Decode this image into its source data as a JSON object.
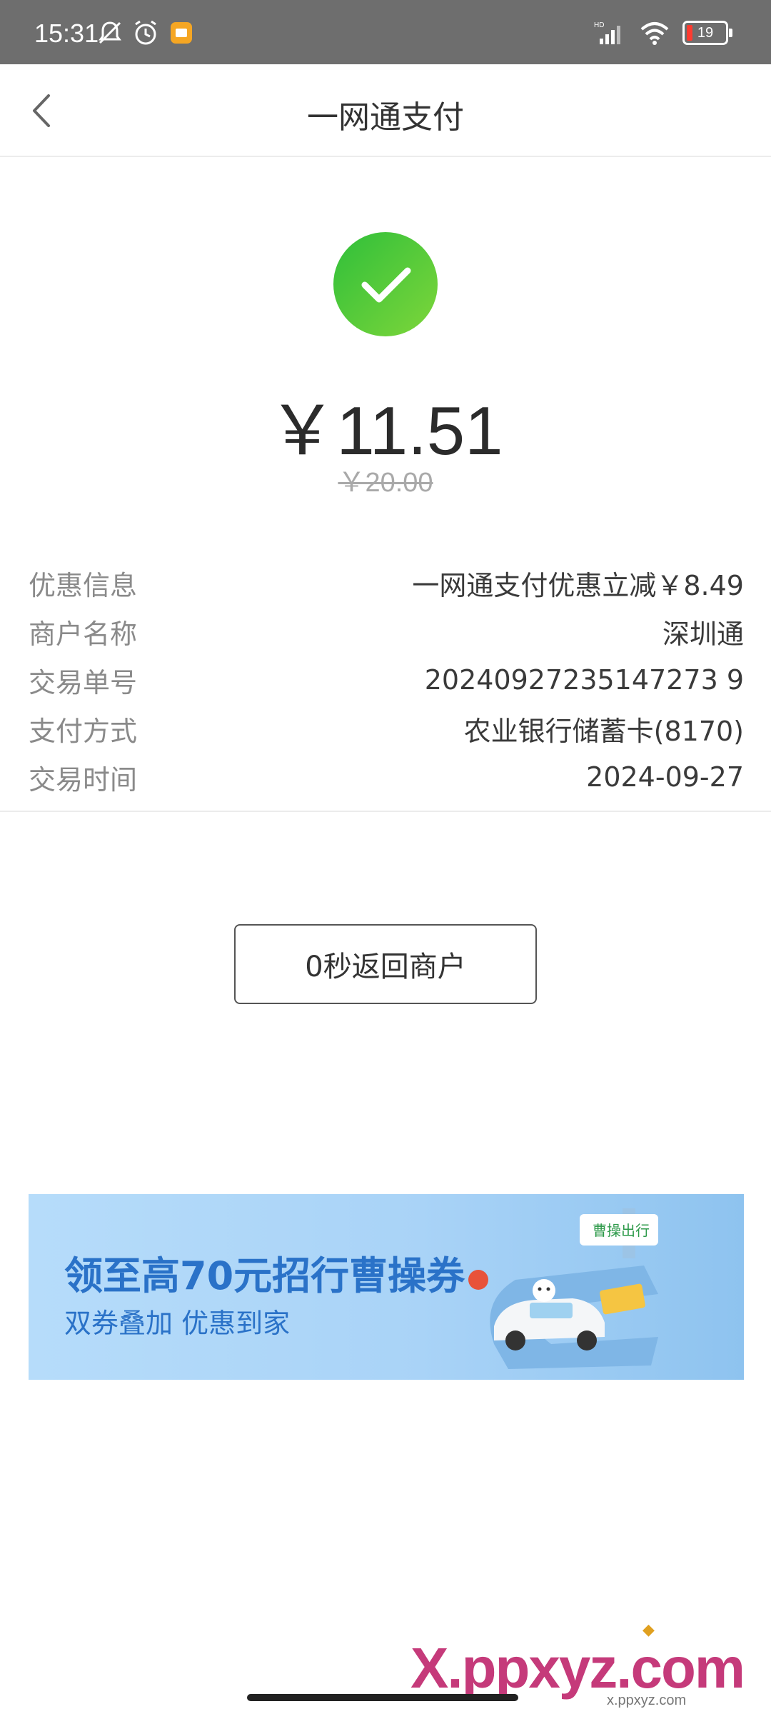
{
  "status_bar": {
    "time": "15:31",
    "battery": "19",
    "icons": [
      "muted-bell-icon",
      "alarm-icon",
      "app-notification-icon",
      "signal-icon",
      "wifi-icon",
      "battery-icon"
    ]
  },
  "header": {
    "title": "一网通支付",
    "back_icon": "chevron-left-icon"
  },
  "result": {
    "status_icon": "check-circle-icon",
    "amount": "￥11.51",
    "original_amount": "￥20.00"
  },
  "details": [
    {
      "label": "优惠信息",
      "value": "一网通支付优惠立减￥8.49"
    },
    {
      "label": "商户名称",
      "value": "深圳通"
    },
    {
      "label": "交易单号",
      "value": "20240927235147273 9"
    },
    {
      "label": "支付方式",
      "value": "农业银行储蓄卡(8170)"
    },
    {
      "label": "交易时间",
      "value": "2024-09-27"
    }
  ],
  "return_button": "0秒返回商户",
  "banner": {
    "title": "领至高70元招行曹操券",
    "subtitle": "双券叠加 优惠到家",
    "brand": "曹操出行"
  },
  "watermark": {
    "text": "X.ppxyz.com",
    "url": "x.ppxyz.com"
  },
  "colors": {
    "success_green": "#3cc03c",
    "banner_blue": "#2a72c8",
    "status_bar": "#6e6e6e"
  }
}
